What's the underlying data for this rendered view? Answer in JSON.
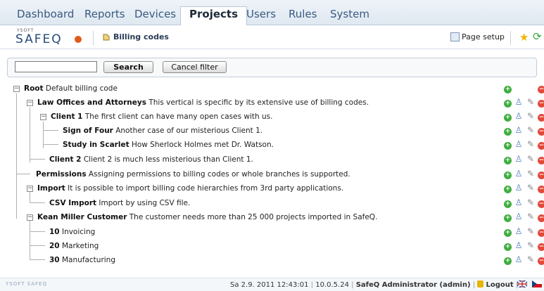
{
  "nav": {
    "tabs": [
      {
        "label": "Dashboard"
      },
      {
        "label": "Reports"
      },
      {
        "label": "Devices"
      },
      {
        "label": "Projects",
        "active": true
      },
      {
        "label": "Users"
      },
      {
        "label": "Rules"
      },
      {
        "label": "System"
      }
    ]
  },
  "header": {
    "logo_small": "YSOFT",
    "logo_big": "SAFEQ",
    "breadcrumb": "Billing codes",
    "page_setup": "Page setup"
  },
  "filter": {
    "search_value": "",
    "search_label": "Search",
    "cancel_label": "Cancel filter"
  },
  "tree": [
    {
      "code": "Root",
      "desc": "Default billing code"
    },
    {
      "code": "Law Offices and Attorneys",
      "desc": "This vertical is specific by its extensive use of billing codes."
    },
    {
      "code": "Client 1",
      "desc": "The first client can have many open cases with us."
    },
    {
      "code": "Sign of Four",
      "desc": "Another case of our misterious Client 1."
    },
    {
      "code": "Study in Scarlet",
      "desc": "How Sherlock Holmes met Dr. Watson."
    },
    {
      "code": "Client 2",
      "desc": "Client 2 is much less misterious than Client 1."
    },
    {
      "code": "Permissions",
      "desc": "Assigning permissions to billing codes or whole branches is supported."
    },
    {
      "code": "Import",
      "desc": "It is possible to import billing code hierarchies from 3rd party applications."
    },
    {
      "code": "CSV Import",
      "desc": "Import by using CSV file."
    },
    {
      "code": "Kean Miller Customer",
      "desc": "The customer needs more than 25 000 projects imported in SafeQ."
    },
    {
      "code": "10",
      "desc": "Invoicing"
    },
    {
      "code": "20",
      "desc": "Marketing"
    },
    {
      "code": "30",
      "desc": "Manufacturing"
    }
  ],
  "footer": {
    "logo": "YSOFT SAFEQ",
    "datetime": "Sa 2.9. 2011 12:43:01",
    "ip": "10.0.5.24",
    "user": "SafeQ Administrator (admin)",
    "logout": "Logout"
  },
  "colors": {
    "accent": "#3a5a80",
    "add": "#3fae3f",
    "delete": "#e34a3a"
  }
}
